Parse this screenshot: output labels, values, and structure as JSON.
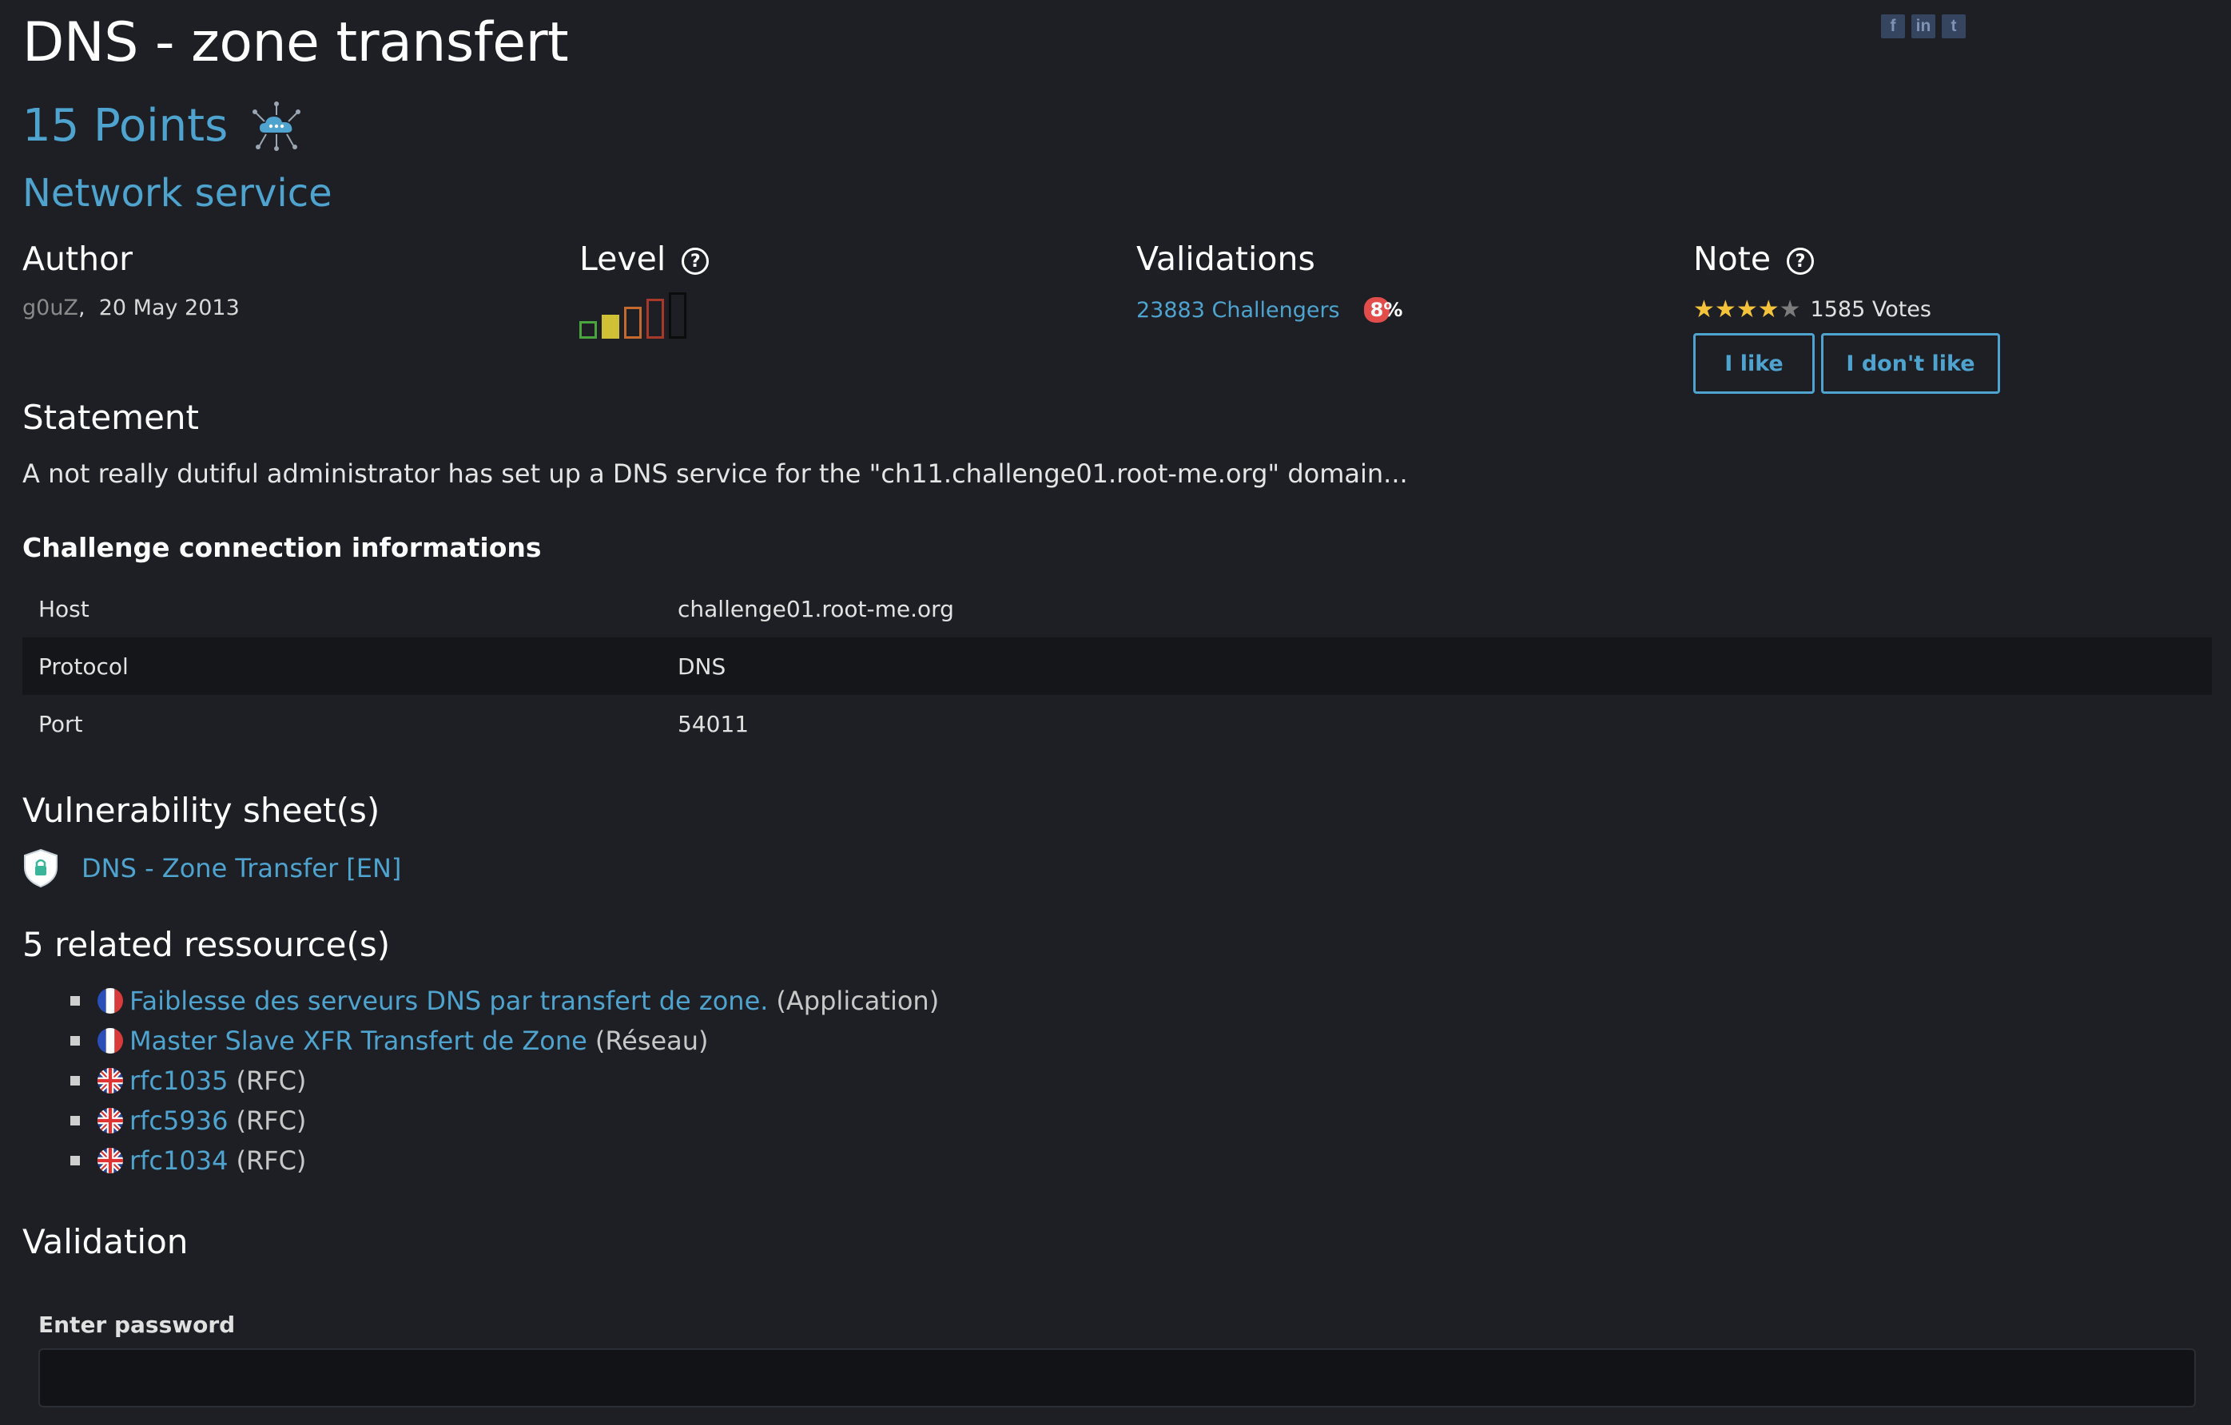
{
  "title": "DNS - zone transfert",
  "share": {
    "facebook": "f",
    "linkedin": "in",
    "twitter": "t"
  },
  "points": "15 Points",
  "category": "Network service",
  "author": {
    "heading": "Author",
    "name": "g0uZ",
    "separator": ",",
    "date": "20 May 2013"
  },
  "level": {
    "heading": "Level",
    "help": "?",
    "value": 2,
    "max": 5
  },
  "validations": {
    "heading": "Validations",
    "challengers": "23883 Challengers",
    "percent": "8%",
    "percent_digit": "8",
    "percent_sign": "%"
  },
  "note": {
    "heading": "Note",
    "help": "?",
    "rating": 4,
    "max": 5,
    "votes": "1585 Votes",
    "like_label": "I like",
    "dislike_label": "I don't like"
  },
  "statement": {
    "heading": "Statement",
    "text": "A not really dutiful administrator has set up a DNS service for the \"ch11.challenge01.root-me.org\" domain..."
  },
  "connection": {
    "heading": "Challenge connection informations",
    "rows": [
      {
        "key": "Host",
        "value": "challenge01.root-me.org"
      },
      {
        "key": "Protocol",
        "value": "DNS"
      },
      {
        "key": "Port",
        "value": "54011"
      }
    ]
  },
  "vulnerability": {
    "heading": "Vulnerability sheet(s)",
    "link": "DNS - Zone Transfer [EN]"
  },
  "resources": {
    "heading": "5 related ressource(s)",
    "items": [
      {
        "lang": "fr",
        "title": "Faiblesse des serveurs DNS par transfert de zone.",
        "type": "(Application)"
      },
      {
        "lang": "fr",
        "title": "Master Slave XFR Transfert de Zone",
        "type": "(Réseau)"
      },
      {
        "lang": "en",
        "title": "rfc1035",
        "type": "(RFC)"
      },
      {
        "lang": "en",
        "title": "rfc5936",
        "type": "(RFC)"
      },
      {
        "lang": "en",
        "title": "rfc1034",
        "type": "(RFC)"
      }
    ]
  },
  "validation": {
    "heading": "Validation",
    "password_label": "Enter password",
    "password_value": ""
  },
  "colors": {
    "background": "#1d1f24",
    "link": "#4ea3cf",
    "star": "#f5c33b",
    "badge": "#e24c4b"
  }
}
